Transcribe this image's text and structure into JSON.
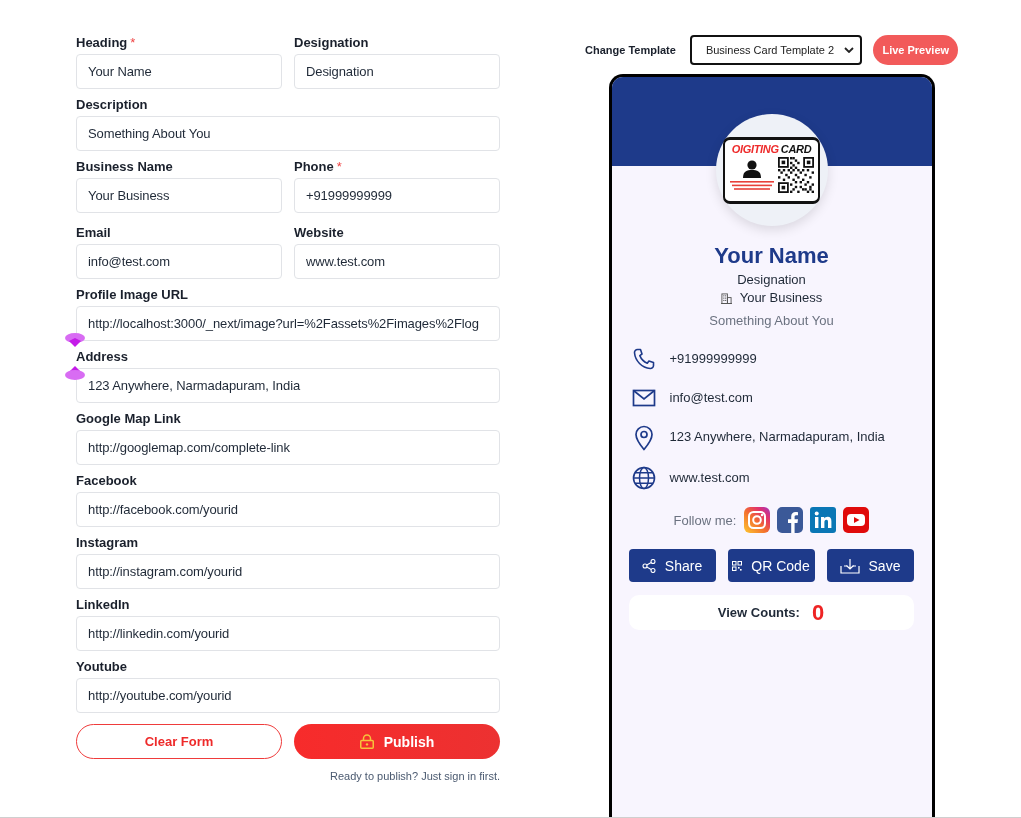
{
  "form": {
    "required_marker": "*",
    "rows": [
      [
        {
          "label": "Heading",
          "required": true,
          "value": "Your Name"
        },
        {
          "label": "Designation",
          "required": false,
          "value": "Designation"
        }
      ],
      [
        {
          "label": "Description",
          "required": false,
          "value": "Something About You"
        }
      ],
      [
        {
          "label": "Business Name",
          "required": false,
          "value": "Your Business"
        },
        {
          "label": "Phone",
          "required": true,
          "value": "+91999999999"
        }
      ],
      [
        {
          "label": "Email",
          "required": false,
          "value": "info@test.com"
        },
        {
          "label": "Website",
          "required": false,
          "value": "www.test.com"
        }
      ],
      [
        {
          "label": "Profile Image URL",
          "required": false,
          "value": "http://localhost:3000/_next/image?url=%2Fassets%2Fimages%2Flog"
        }
      ],
      [
        {
          "label": "Address",
          "required": false,
          "value": "123 Anywhere, Narmadapuram, India"
        }
      ],
      [
        {
          "label": "Google Map Link",
          "required": false,
          "value": "http://googlemap.com/complete-link"
        }
      ],
      [
        {
          "label": "Facebook",
          "required": false,
          "value": "http://facebook.com/yourid"
        }
      ],
      [
        {
          "label": "Instagram",
          "required": false,
          "value": "http://instagram.com/yourid"
        }
      ],
      [
        {
          "label": "LinkedIn",
          "required": false,
          "value": "http://linkedin.com/yourid"
        }
      ],
      [
        {
          "label": "Youtube",
          "required": false,
          "value": "http://youtube.com/yourid"
        }
      ]
    ],
    "buttons": [
      {
        "kind": "clear",
        "label": "Clear Form"
      },
      {
        "kind": "publish",
        "label": "Publish"
      }
    ],
    "note": "Ready to publish? Just sign in first."
  },
  "template_bar": {
    "label": "Change Template",
    "selected_template": "Business Card Template 2",
    "preview_button": "Live Preview"
  },
  "card": {
    "logo_words": [
      "OIGITING",
      "CARD"
    ],
    "name": "Your Name",
    "designation": "Designation",
    "business": "Your Business",
    "description": "Something About You",
    "contacts": [
      {
        "kind": "phone",
        "text": "+91999999999"
      },
      {
        "kind": "email",
        "text": "info@test.com"
      },
      {
        "kind": "address",
        "text": "123 Anywhere, Narmadapuram, India"
      },
      {
        "kind": "website",
        "text": "www.test.com"
      }
    ],
    "follow_label": "Follow me:",
    "socials": [
      {
        "kind": "instagram"
      },
      {
        "kind": "facebook"
      },
      {
        "kind": "linkedin"
      },
      {
        "kind": "youtube"
      }
    ],
    "actions": [
      {
        "kind": "share",
        "label": "Share"
      },
      {
        "kind": "qr",
        "label": "QR Code"
      },
      {
        "kind": "save",
        "label": "Save"
      }
    ],
    "view_counts": {
      "label": "View Counts:",
      "value": "0"
    }
  }
}
